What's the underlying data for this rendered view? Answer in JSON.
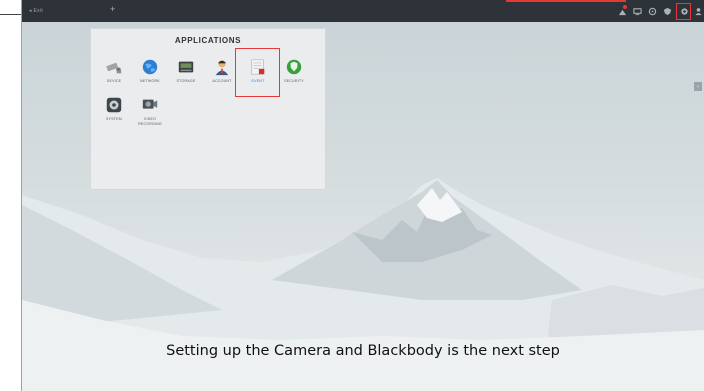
{
  "topbar": {
    "back_label": "◂ Exit",
    "plus_label": "+",
    "icons": [
      "alarm-icon",
      "monitor-icon",
      "target-icon",
      "shield-icon",
      "settings-icon",
      "user-icon"
    ]
  },
  "panel": {
    "title": "APPLICATIONS",
    "apps": [
      {
        "label": "DEVICE",
        "icon": "camera-icon"
      },
      {
        "label": "NETWORK",
        "icon": "globe-icon"
      },
      {
        "label": "STORAGE",
        "icon": "storage-icon"
      },
      {
        "label": "ACCOUNT",
        "icon": "account-icon"
      },
      {
        "label": "EVENT",
        "icon": "event-icon",
        "highlighted": true
      },
      {
        "label": "SECURITY",
        "icon": "security-icon"
      },
      {
        "label": "SYSTEM",
        "icon": "system-icon"
      },
      {
        "label": "VIDEO RECORDING",
        "icon": "video-recording-icon"
      }
    ]
  },
  "caption": "Setting up the Camera and Blackbody is the next step",
  "colors": {
    "highlight": "#e53935",
    "topbar": "#2d3338",
    "panel": "#eaeced"
  }
}
